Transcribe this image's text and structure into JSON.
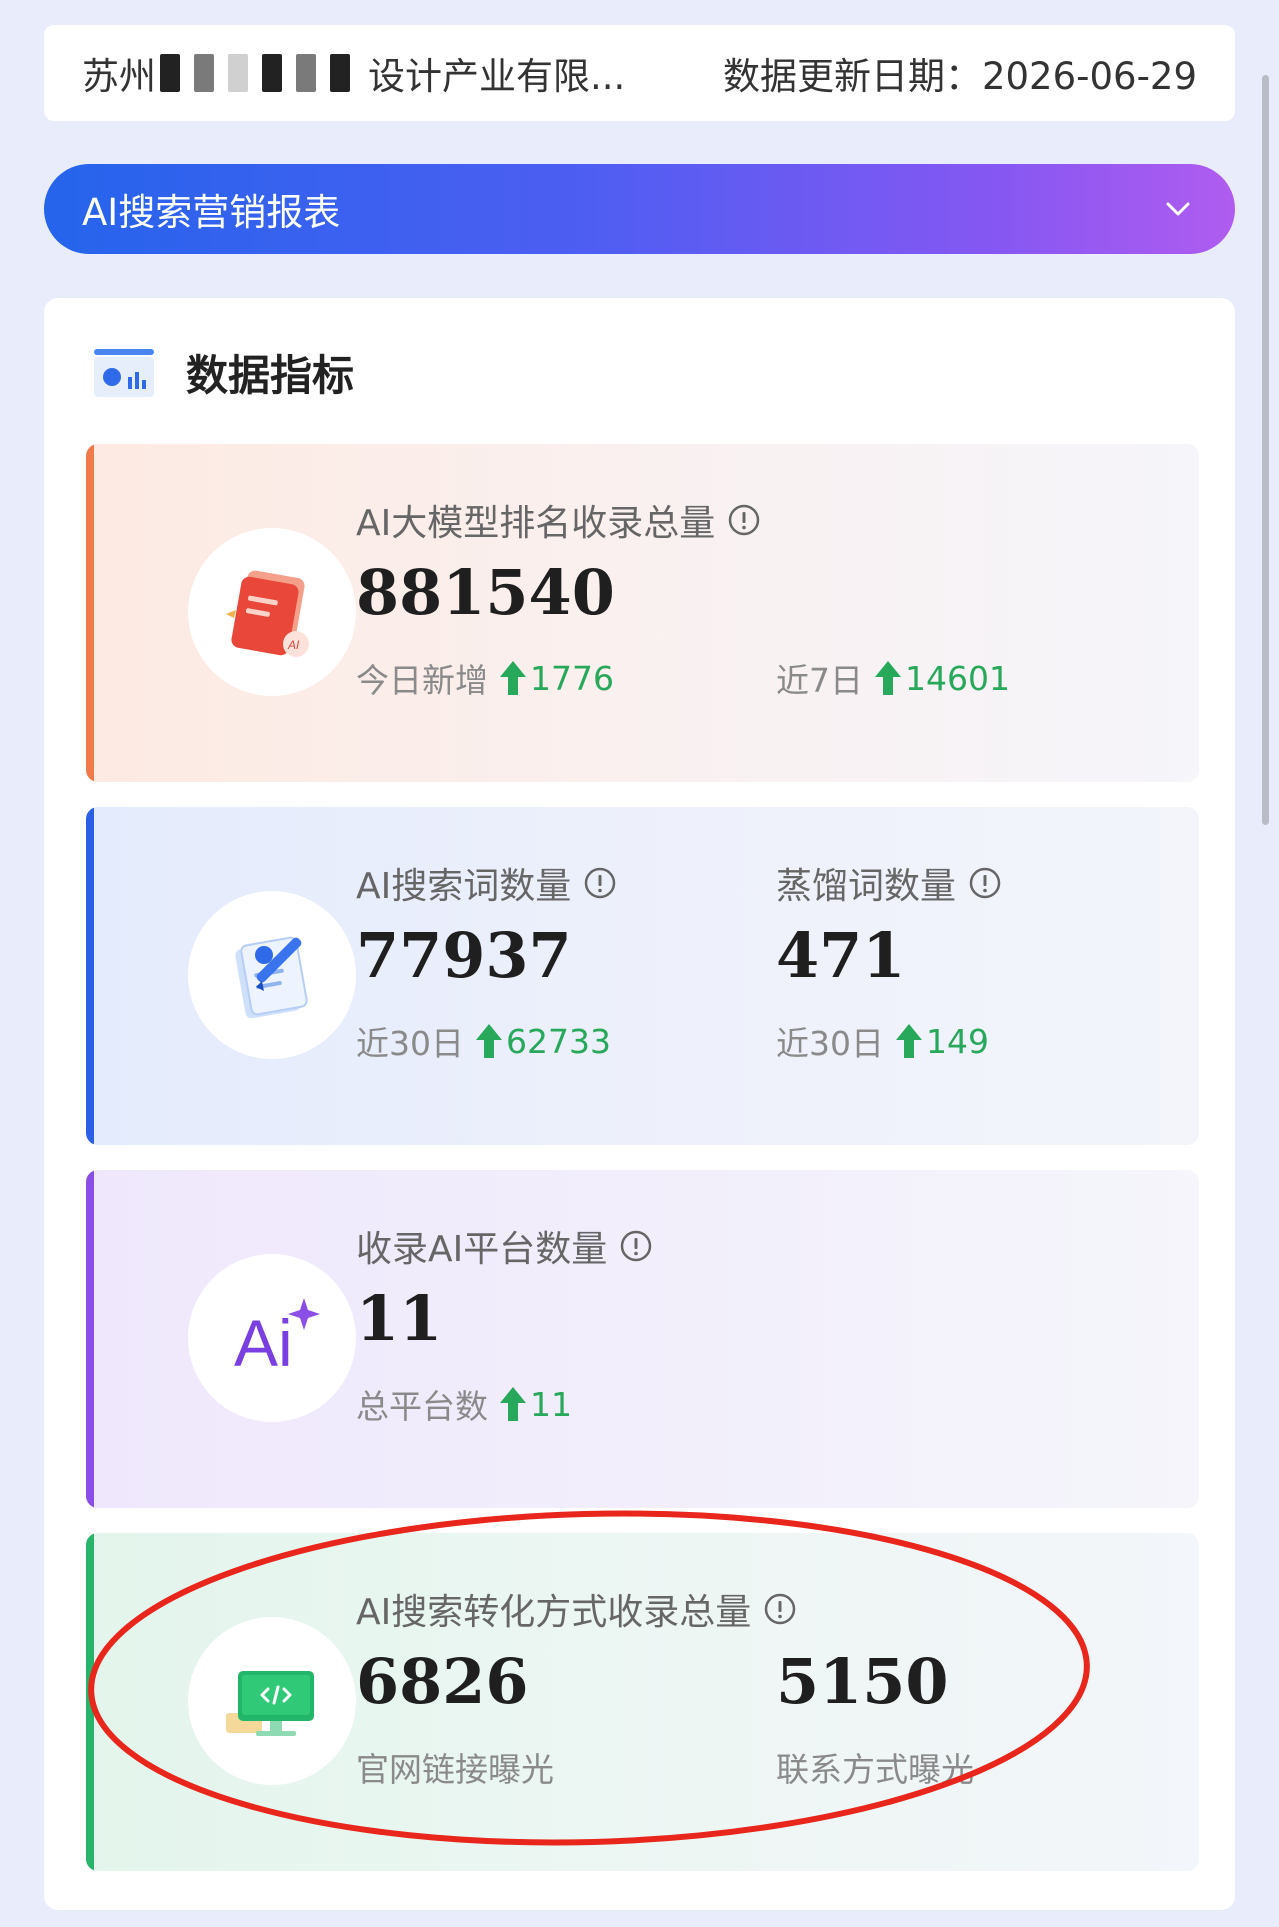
{
  "header": {
    "company_prefix": "苏州",
    "company_suffix": "设计产业有限...",
    "update_label": "数据更新日期：",
    "update_date": "2026-06-29"
  },
  "report_selector": {
    "label": "AI搜索营销报表",
    "icon": "chevron-down-icon"
  },
  "panel": {
    "title": "数据指标",
    "icon": "data-chart-icon"
  },
  "cards": [
    {
      "icon": "ai-document-icon",
      "accent": "#f07a4a",
      "label": "AI大模型排名收录总量",
      "value": "881540",
      "today_label": "今日新增",
      "today_value": "1776",
      "week_label": "近7日",
      "week_value": "14601"
    },
    {
      "icon": "notepad-pen-icon",
      "accent": "#2a5fe6",
      "left": {
        "label": "AI搜索词数量",
        "value": "77937",
        "sub_label": "近30日",
        "sub_value": "62733"
      },
      "right": {
        "label": "蒸馏词数量",
        "value": "471",
        "sub_label": "近30日",
        "sub_value": "149"
      }
    },
    {
      "icon": "ai-sparkle-icon",
      "icon_text": "Ai",
      "accent": "#8a4ee6",
      "label": "收录AI平台数量",
      "value": "11",
      "sub_label": "总平台数",
      "sub_value": "11"
    },
    {
      "icon": "code-monitor-icon",
      "accent": "#27b36a",
      "label": "AI搜索转化方式收录总量",
      "left": {
        "value": "6826",
        "caption": "官网链接曝光"
      },
      "right": {
        "value": "5150",
        "caption": "联系方式曝光"
      }
    }
  ],
  "colors": {
    "trend_up": "#27a85a",
    "highlight_ellipse": "#e8261c"
  }
}
